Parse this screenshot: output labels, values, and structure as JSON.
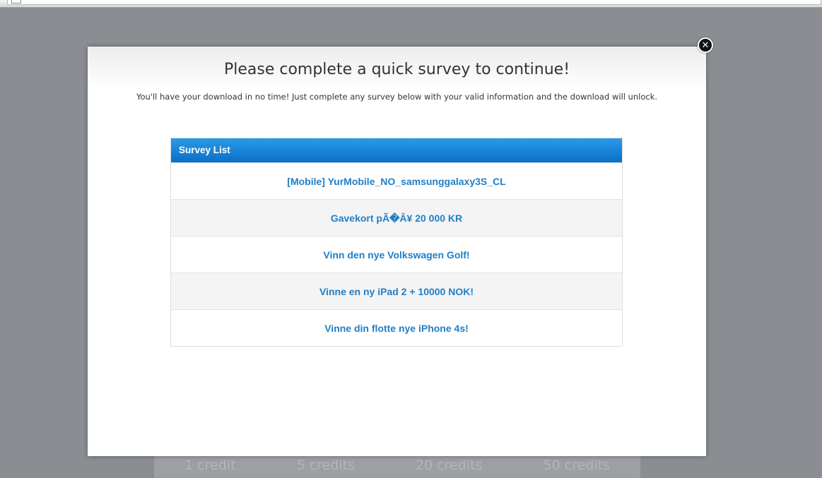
{
  "page": {
    "overlay_color": "#8a8d91"
  },
  "background": {
    "credit_options": [
      "1 credit",
      "5 credits",
      "20 credits",
      "50 credits"
    ]
  },
  "modal": {
    "title": "Please complete a quick survey to continue!",
    "subtitle": "You'll have your download in no time! Just complete any survey below with your valid information and the download will unlock.",
    "close_icon": "close-icon",
    "close_glyph": "✕"
  },
  "survey_list": {
    "header": "Survey List",
    "header_color": "#0b6fc8",
    "link_color": "#1f7fc7",
    "items": [
      "[Mobile] YurMobile_NO_samsunggalaxy3S_CL",
      "Gavekort pÃ�Â¥ 20 000 KR",
      "Vinn den nye Volkswagen Golf!",
      "Vinne en ny iPad 2 + 10000 NOK!",
      "Vinne din flotte nye iPhone 4s!"
    ]
  }
}
